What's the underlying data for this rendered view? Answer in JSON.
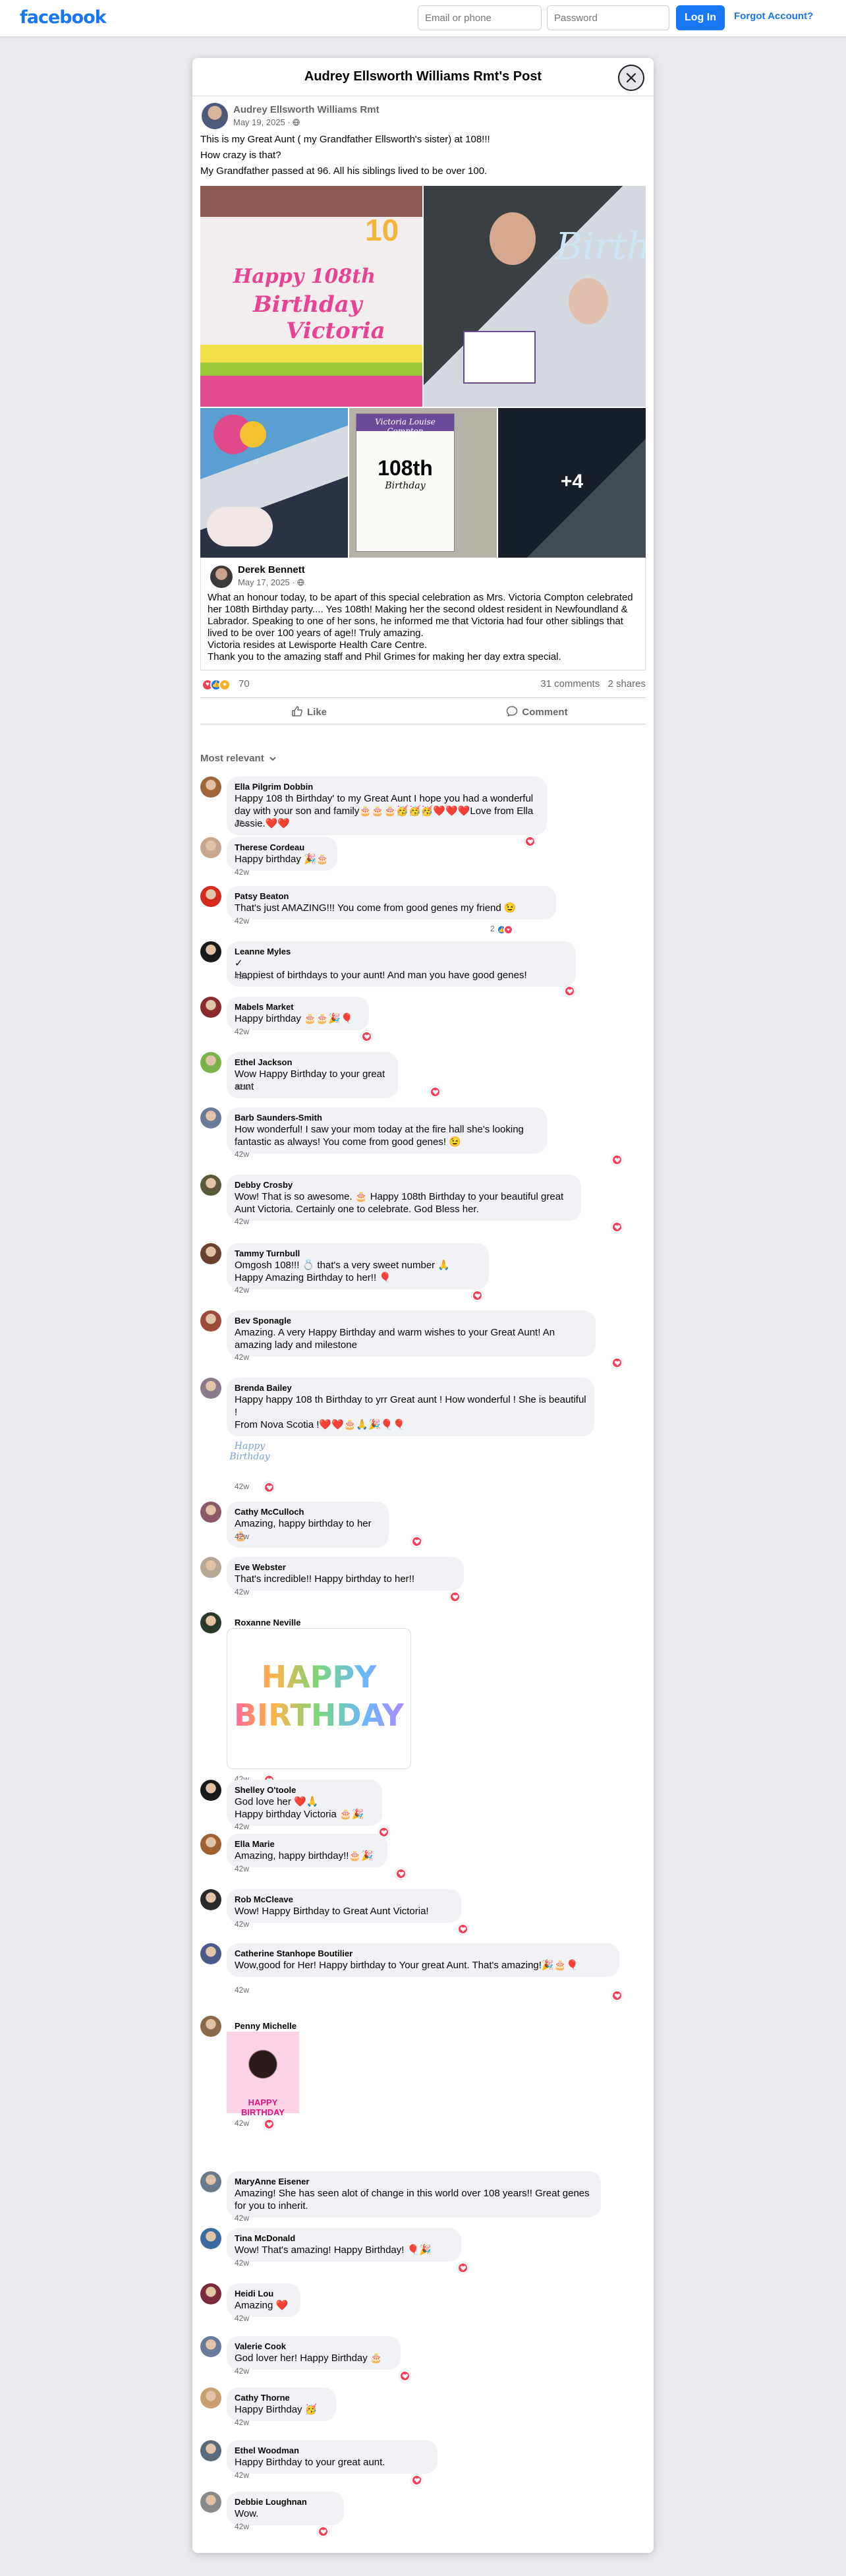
{
  "topbar": {
    "logo": "facebook",
    "email_placeholder": "Email or phone",
    "password_placeholder": "Password",
    "login_label": "Log In",
    "forgot_label": "Forgot Account?"
  },
  "modal": {
    "title": "Audrey Ellsworth Williams Rmt's Post",
    "close_icon": "close-icon"
  },
  "post": {
    "author": "Audrey Ellsworth Williams Rmt",
    "date": "May 19, 2025 · ",
    "privacy_icon": "globe-icon",
    "lines": [
      "This is my Great Aunt ( my Grandfather Ellsworth's sister) at 108!!!",
      "How crazy is that?",
      "My Grandfather passed at 96. All his siblings lived to be over 100."
    ],
    "photos": {
      "cake_line1": "Happy 108th",
      "cake_line2": "Birthday",
      "cake_line3": "Victoria",
      "candle_number": "10",
      "balloon_text": "Birth",
      "poster_header": "Victoria Louise Compton",
      "poster_big": "108th",
      "poster_small": "Birthday",
      "more_count": "+4"
    },
    "shared": {
      "author": "Derek Bennett",
      "date": "May 17, 2025 · ",
      "text": "What an honour today, to be apart of this special celebration as Mrs. Victoria Compton celebrated her 108th Birthday party.... Yes 108th!  Making her the second oldest resident in Newfoundland & Labrador.   Speaking to one of her sons, he informed me that Victoria had four other siblings that lived to be over 100 years of age!!  Truly amazing.\nVictoria resides at Lewisporte Health Care Centre.\nThank you to the amazing staff and Phil Grimes for making her day extra special."
    },
    "reaction_count": "70",
    "comments_count": "31 comments",
    "shares_count": "2 shares",
    "like_label": "Like",
    "comment_label": "Comment"
  },
  "comments_section": {
    "sort_label": "Most relevant"
  },
  "comments": [
    {
      "name": "Ella Pilgrim Dobbin",
      "text": "Happy 108 th Birthday' to my Great Aunt I hope you had a wonderful day with your son and family🎂🎂🎂🥳🥳🥳❤️❤️❤️Love from Ella Jessie.❤️❤️",
      "time": "42w",
      "avatar_color": "#a0663a"
    },
    {
      "name": "Therese Cordeau",
      "text": "Happy birthday 🎉🎂",
      "time": "42w",
      "avatar_color": "#c8a890"
    },
    {
      "name": "Patsy Beaton",
      "text": "That's just AMAZING!!! You come from good genes my friend 😉",
      "time": "42w",
      "avatar_color": "#d52b1e",
      "reactions": "2"
    },
    {
      "name": "Leanne Myles",
      "verified": true,
      "text": "Happiest of birthdays to your aunt! And man you have good genes!",
      "time": "42w",
      "avatar_color": "#1a1a1a"
    },
    {
      "name": "Mabels Market",
      "text": "Happy birthday 🎂🎂🎉🎈",
      "time": "42w",
      "avatar_color": "#8b2d2d"
    },
    {
      "name": "Ethel Jackson",
      "text": "Wow Happy Birthday to your great aunt",
      "time": "42w",
      "avatar_color": "#7bb24a"
    },
    {
      "name": "Barb Saunders-Smith",
      "text": "How wonderful! I saw your mom today at the fire hall she's looking fantastic as always! You come from good genes! 😉",
      "time": "42w",
      "avatar_color": "#6c7a99"
    },
    {
      "name": "Debby Crosby",
      "text": "Wow! That is so awesome. 🎂 Happy 108th Birthday to your beautiful great Aunt Victoria. Certainly one to celebrate. God Bless her.",
      "time": "42w",
      "avatar_color": "#5a5a3a"
    },
    {
      "name": "Tammy Turnbull",
      "text": "Omgosh 108!!! 💍 that's a very sweet number 🙏\nHappy Amazing Birthday to her!! 🎈",
      "time": "42w",
      "avatar_color": "#6a4030"
    },
    {
      "name": "Bev Sponagle",
      "text": "Amazing. A very Happy Birthday and warm wishes to your Great Aunt! An amazing lady and milestone",
      "time": "42w",
      "avatar_color": "#9a4a3a"
    },
    {
      "name": "Brenda Bailey",
      "text": "Happy happy 108 th Birthday to yrr Great aunt ! How wonderful ! She is beautiful !\nFrom Nova Scotia !❤️❤️🎂🙏🎉🎈🎈",
      "time": "42w",
      "avatar_color": "#8a7a8a",
      "sticker": "Happy Birthday"
    },
    {
      "name": "Cathy McCulloch",
      "text": "Amazing, happy birthday to her 🎂",
      "time": "42w",
      "avatar_color": "#8a5a6a"
    },
    {
      "name": "Eve Webster",
      "text": "That's incredible!! Happy birthday to her!!",
      "time": "42w",
      "avatar_color": "#b8a898"
    },
    {
      "name": "Roxanne Neville",
      "text": "",
      "time": "42w",
      "avatar_color": "#2a3a2a",
      "sticker": "HAPPY BIRTHDAY"
    },
    {
      "name": "Shelley O'toole",
      "text": "God love her ❤️🙏\nHappy birthday Victoria 🎂🎉",
      "time": "42w",
      "avatar_color": "#1a1a1a"
    },
    {
      "name": "Ella Marie",
      "text": "Amazing, happy birthday!!🎂🎉",
      "time": "42w",
      "avatar_color": "#a06030"
    },
    {
      "name": "Rob McCleave",
      "text": "Wow! Happy Birthday to Great Aunt Victoria!",
      "time": "42w",
      "avatar_color": "#2a2a2a"
    },
    {
      "name": "Catherine Stanhope Boutilier",
      "text": "Wow,good for Her! Happy birthday to Your great Aunt. That's amazing!🎉🎂🎈",
      "time": "42w",
      "avatar_color": "#4a5a8a"
    },
    {
      "name": "Penny Michelle",
      "text": "",
      "time": "42w",
      "avatar_color": "#8a6a4a",
      "sticker": "HAPPY BIRTHDAY"
    },
    {
      "name": "MaryAnne Eisener",
      "text": "Amazing! She has seen alot of change in this world over 108 years!! Great genes for you to inherit.",
      "time": "42w",
      "avatar_color": "#6a7a8a"
    },
    {
      "name": "Tina McDonald",
      "text": "Wow! That's amazing! Happy Birthday! 🎈🎉",
      "time": "42w",
      "avatar_color": "#3a6aa0"
    },
    {
      "name": "Heidi Lou",
      "text": "Amazing ❤️",
      "time": "42w",
      "avatar_color": "#7a2a3a"
    },
    {
      "name": "Valerie Cook",
      "text": "God lover her! Happy Birthday 🎂",
      "time": "42w",
      "avatar_color": "#6a7a9a"
    },
    {
      "name": "Cathy Thorne",
      "text": "Happy Birthday 🥳",
      "time": "42w",
      "avatar_color": "#c8a070"
    },
    {
      "name": "Ethel Woodman",
      "text": "Happy Birthday to your great aunt.",
      "time": "42w",
      "avatar_color": "#5a6a7a"
    },
    {
      "name": "Debbie Loughnan",
      "text": "Wow.",
      "time": "42w",
      "avatar_color": "#8a8a8a"
    }
  ],
  "colors": {
    "brand": "#1877f2",
    "love": "#f33e58",
    "bubble": "#f0f2f5"
  }
}
